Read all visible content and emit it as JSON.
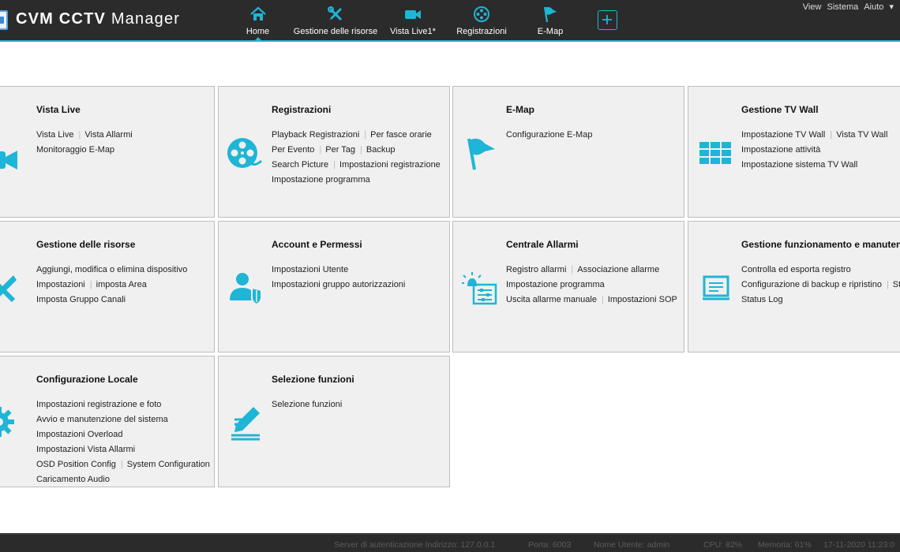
{
  "app": {
    "title_bold": "CVM CCTV",
    "title_light": "Manager"
  },
  "top_menu": {
    "view": "View",
    "system": "Sistema",
    "help": "Aiuto"
  },
  "accent_color": "#1fb5d6",
  "nav_tabs": [
    {
      "label": "Home",
      "icon": "home-icon",
      "active": true
    },
    {
      "label": "Gestione delle risorse",
      "icon": "tools-icon"
    },
    {
      "label": "Vista Live1*",
      "icon": "video-camera-icon"
    },
    {
      "label": "Registrazioni",
      "icon": "film-reel-icon"
    },
    {
      "label": "E-Map",
      "icon": "flag-icon"
    }
  ],
  "cards": {
    "vista_live": {
      "title": "Vista Live",
      "icon": "video-camera-icon",
      "links": [
        "Vista Live",
        "Vista Allarmi",
        "Monitoraggio E-Map"
      ]
    },
    "registrazioni": {
      "title": "Registrazioni",
      "icon": "film-reel-icon",
      "links": [
        "Playback Registrazioni",
        "Per fasce orarie",
        "Per Evento",
        "Per Tag",
        "Backup",
        "Search Picture",
        "Impostazioni registrazione",
        "Impostazione programma"
      ]
    },
    "emap": {
      "title": "E-Map",
      "icon": "flag-icon",
      "links": [
        "Configurazione E-Map"
      ]
    },
    "tv_wall": {
      "title": "Gestione TV Wall",
      "icon": "tv-wall-grid-icon",
      "links": [
        "Impostazione TV Wall",
        "Vista TV Wall",
        "Impostazione attività",
        "Impostazione sistema TV Wall"
      ]
    },
    "risorse": {
      "title": "Gestione delle risorse",
      "icon": "tools-icon",
      "links": [
        "Aggiungi, modifica o elimina dispositivo",
        "Impostazioni",
        "imposta Area",
        "Imposta Gruppo Canali"
      ]
    },
    "account": {
      "title": "Account e Permessi",
      "icon": "user-shield-icon",
      "links": [
        "Impostazioni Utente",
        "Impostazioni gruppo autorizzazioni"
      ]
    },
    "allarmi": {
      "title": "Centrale Allarmi",
      "icon": "alarm-panel-icon",
      "links": [
        "Registro allarmi",
        "Associazione allarme",
        "Impostazione programma",
        "Uscita allarme manuale",
        "Impostazioni SOP"
      ]
    },
    "manutenzione": {
      "title": "Gestione funzionamento e manutenzio",
      "icon": "monitor-icon",
      "links": [
        "Controlla ed esporta registro",
        "Configurazione di backup e ripristino",
        "Sta",
        "Status Log"
      ]
    },
    "locale": {
      "title": "Configurazione Locale",
      "icon": "gear-icon",
      "links": [
        "Impostazioni registrazione e foto",
        "Avvio e manutenzione del sistema",
        "Impostazioni Overload",
        "Impostazioni Vista Allarmi",
        "OSD Position Config",
        "System Configuration",
        "Caricamento Audio"
      ]
    },
    "funzioni": {
      "title": "Selezione funzioni",
      "icon": "pen-edit-icon",
      "links": [
        "Selezione funzioni"
      ]
    }
  },
  "status": {
    "server": "Server di autenticazione Indirizzo: 127.0.0.1",
    "port": "Porta: 6003",
    "user": "Nome Utente: admin",
    "cpu": "CPU: 82%",
    "memory": "Memoria: 61%",
    "datetime": "17-11-2020 11:23:0"
  }
}
